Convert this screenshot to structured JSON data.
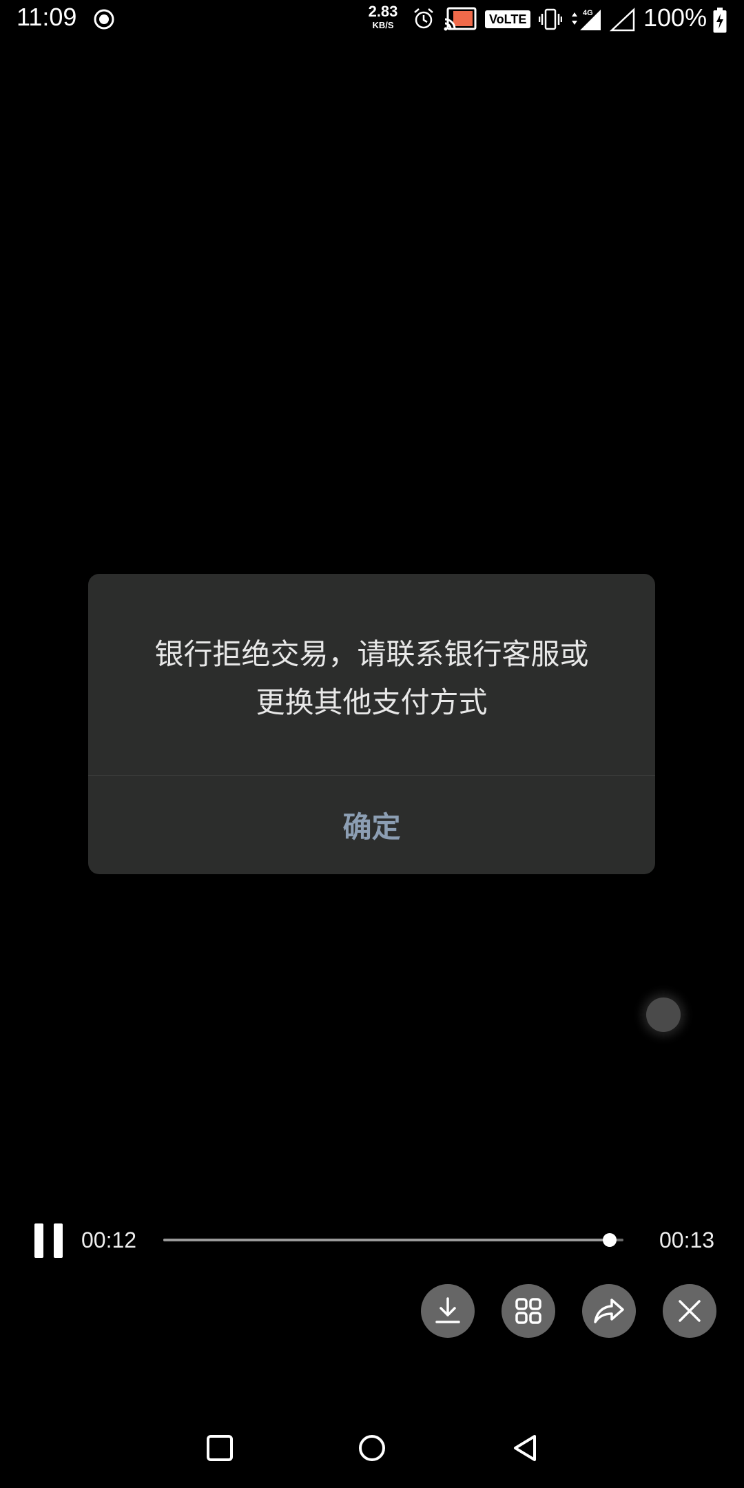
{
  "status_bar": {
    "time": "11:09",
    "net_speed_value": "2.83",
    "net_speed_unit": "KB/S",
    "volte_label": "VoLTE",
    "network_label": "4G",
    "battery_percent": "100%",
    "icons": [
      "record-icon",
      "alarm-icon",
      "cast-icon",
      "vibrate-icon",
      "signal-4g-icon",
      "signal-icon",
      "battery-charging-icon"
    ]
  },
  "dialog": {
    "message_line1": "银行拒绝交易，请联系银行客服或",
    "message_line2": "更换其他支付方式",
    "confirm_label": "确定"
  },
  "player": {
    "current_time": "00:12",
    "total_time": "00:13",
    "progress_fraction": 0.97,
    "actions": [
      "download-icon",
      "grid-icon",
      "share-icon",
      "close-icon"
    ]
  },
  "colors": {
    "dialog_bg": "#2c2d2c",
    "confirm_text": "#8c9eb3",
    "action_button_bg": "#666666"
  }
}
